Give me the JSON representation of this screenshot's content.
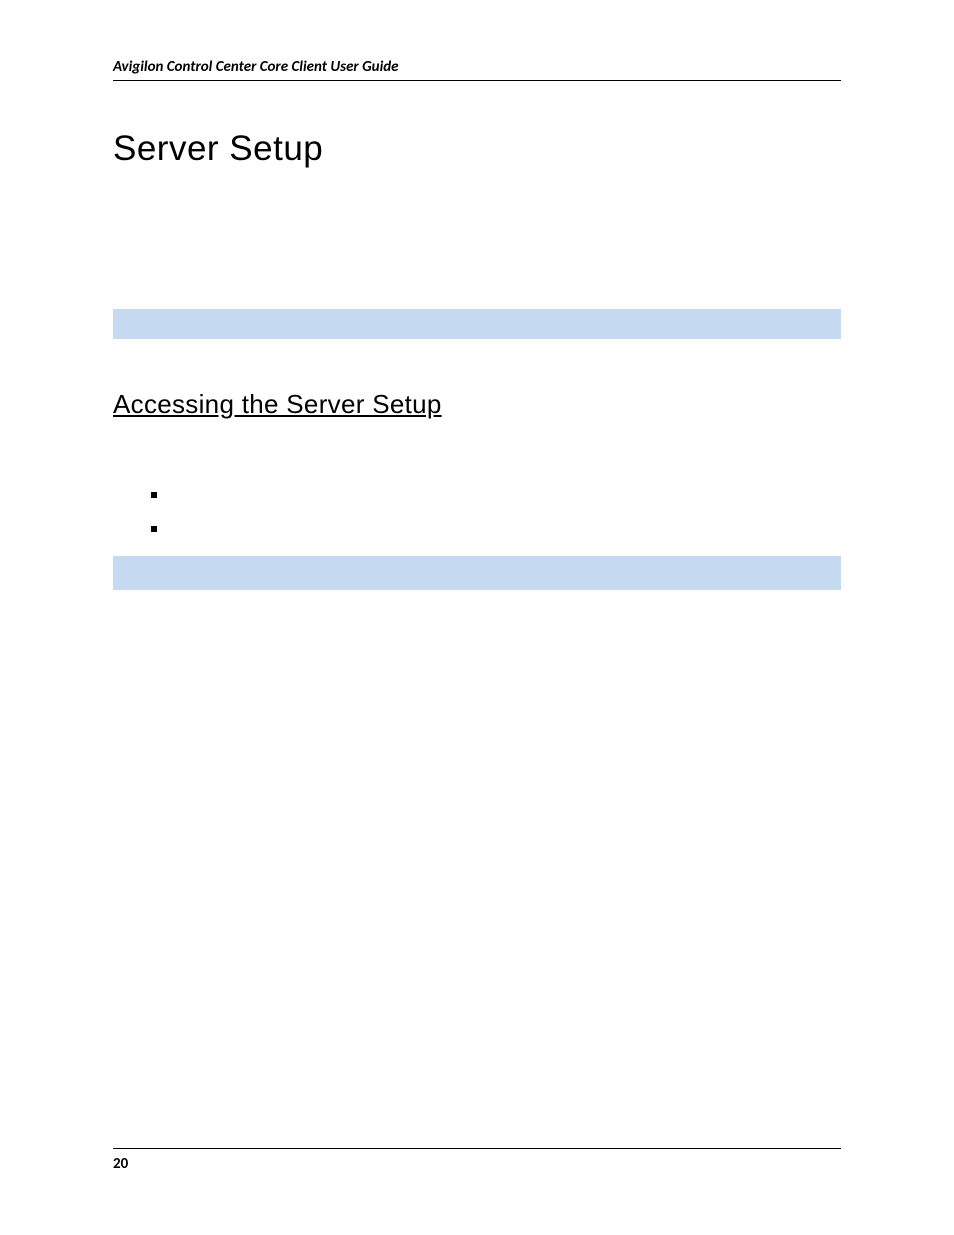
{
  "header": {
    "running_title": "Avigilon Control Center Core Client User Guide"
  },
  "content": {
    "title": "Server Setup",
    "section_heading": "Accessing the Server Setup",
    "bullets": [
      "",
      ""
    ]
  },
  "footer": {
    "page_number": "20"
  }
}
